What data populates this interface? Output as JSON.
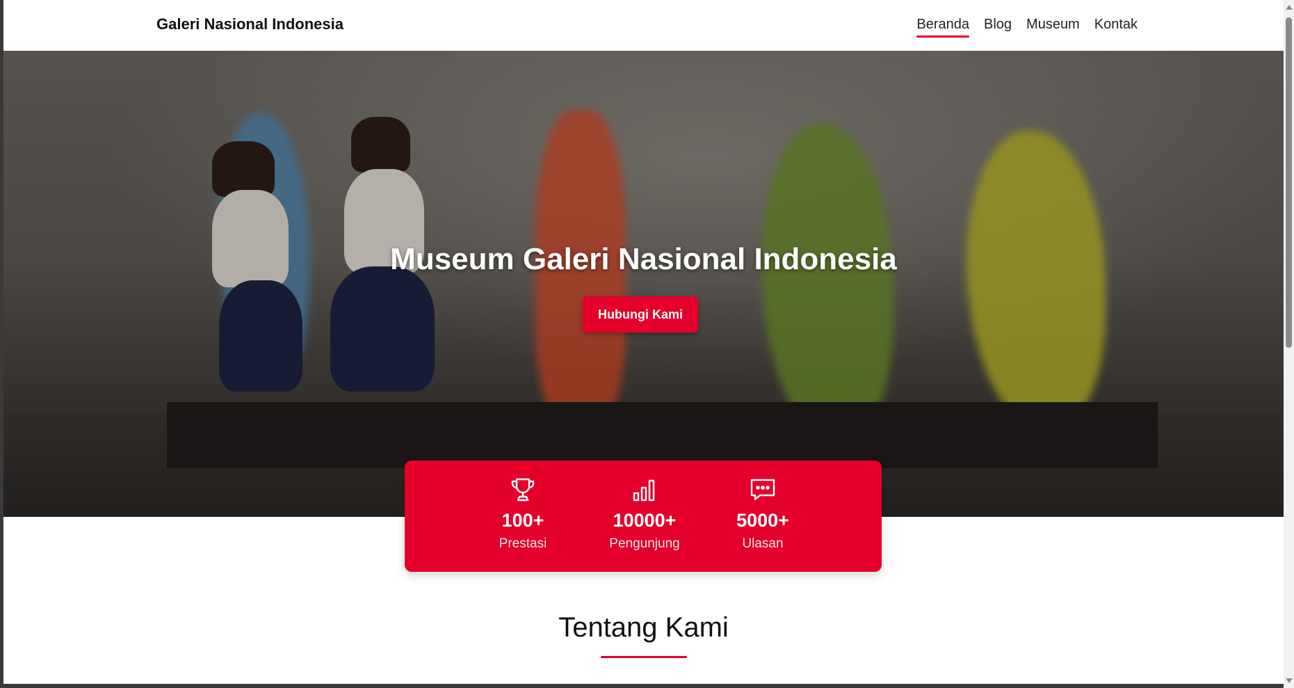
{
  "navbar": {
    "brand": "Galeri Nasional Indonesia",
    "links": [
      {
        "label": "Beranda",
        "active": true
      },
      {
        "label": "Blog",
        "active": false
      },
      {
        "label": "Museum",
        "active": false
      },
      {
        "label": "Kontak",
        "active": false
      }
    ]
  },
  "hero": {
    "title": "Museum Galeri Nasional Indonesia",
    "button_label": "Hubungi Kami",
    "image_description": "students walking past colorful sculptures in gallery"
  },
  "stats": [
    {
      "icon": "trophy-icon",
      "value": "100+",
      "label": "Prestasi"
    },
    {
      "icon": "bar-chart-icon",
      "value": "10000+",
      "label": "Pengunjung"
    },
    {
      "icon": "chat-bubble-icon",
      "value": "5000+",
      "label": "Ulasan"
    }
  ],
  "about": {
    "title": "Tentang Kami"
  },
  "colors": {
    "accent": "#e4002b",
    "background": "#ffffff",
    "text": "#111111"
  }
}
